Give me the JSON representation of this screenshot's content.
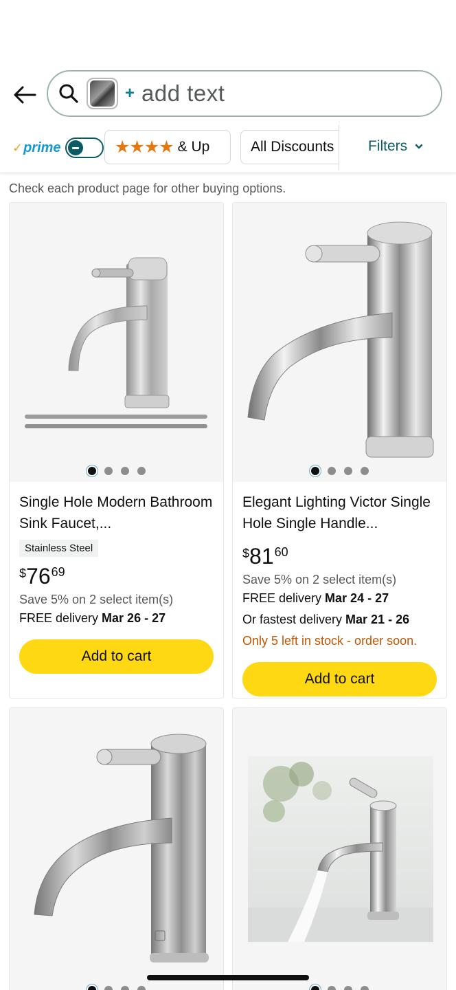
{
  "search": {
    "plus": "+",
    "placeholder": "add text"
  },
  "filters": {
    "prime_label": "prime",
    "prime_check": "✓",
    "stars": "★★★★",
    "stars_suffix": "& Up",
    "discounts": "All Discounts",
    "filters_label": "Filters"
  },
  "note": "Check each product page for other buying options.",
  "products": [
    {
      "title": "Single Hole Modern Bathroom Sink Faucet,...",
      "badge": "Stainless Steel",
      "price_symbol": "$",
      "price_whole": "76",
      "price_fraction": "69",
      "save": "Save 5% on 2 select item(s)",
      "delivery_prefix": "FREE delivery ",
      "delivery_dates": "Mar 26 - 27",
      "cart": "Add to cart"
    },
    {
      "title": "Elegant Lighting Victor Single Hole Single Handle...",
      "price_symbol": "$",
      "price_whole": "81",
      "price_fraction": "60",
      "save": "Save 5% on 2 select item(s)",
      "delivery_prefix": "FREE delivery ",
      "delivery_dates": "Mar 24 - 27",
      "fastest_prefix": "Or fastest delivery ",
      "fastest_dates": "Mar 21 - 26",
      "stock": "Only 5 left in stock - order soon.",
      "cart": "Add to cart"
    }
  ],
  "colors": {
    "accent": "#0b5b66",
    "cart_button": "#ffd814",
    "stars": "#e47911",
    "stock_warning": "#c45500"
  }
}
